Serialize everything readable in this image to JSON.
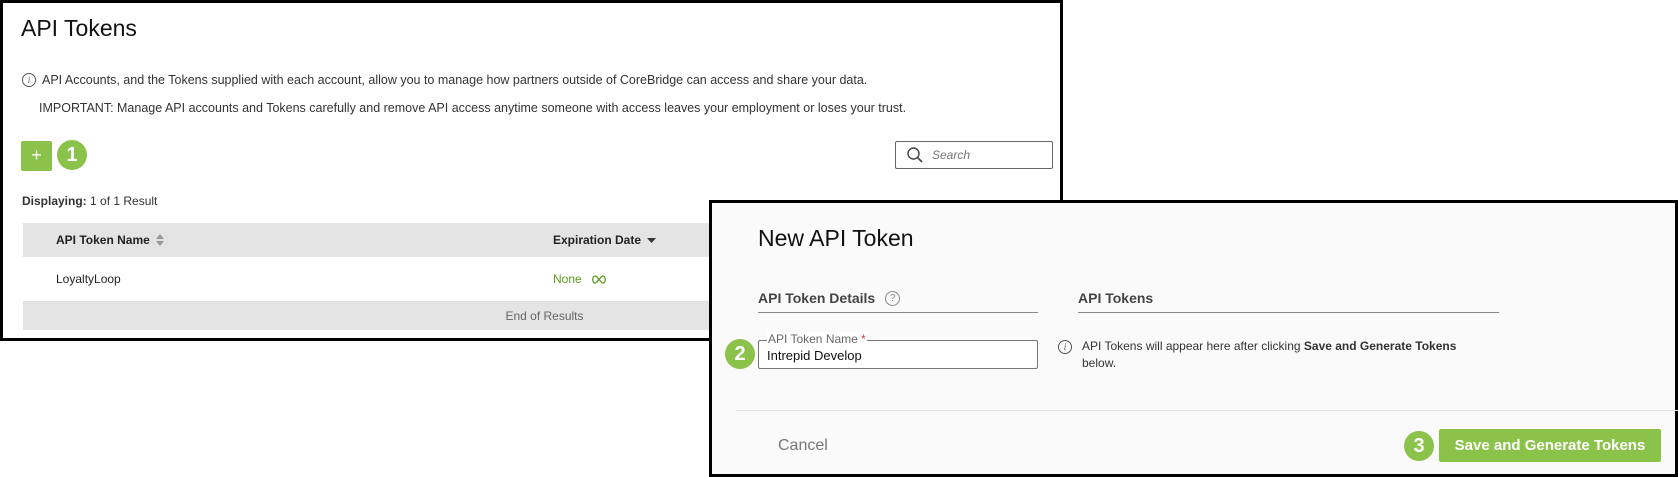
{
  "tokens_page": {
    "title": "API Tokens",
    "info_text": "API Accounts, and the Tokens supplied with each account, allow you to manage how partners outside of CoreBridge can access and share your data.",
    "important_text": "IMPORTANT: Manage API accounts and Tokens carefully and remove API access anytime someone with access leaves your employment or loses your trust.",
    "add_button_label": "+",
    "step1": "1",
    "search_placeholder": "Search",
    "displaying_label": "Displaying:",
    "displaying_value": " 1 of 1 Result",
    "table": {
      "col_name": "API Token Name",
      "col_expiration": "Expiration Date",
      "rows": [
        {
          "name": "LoyaltyLoop",
          "expiration": "None"
        }
      ],
      "end_text": "End of Results"
    }
  },
  "modal": {
    "title": "New API Token",
    "details_header": "API Token Details",
    "tokens_header": "API Tokens",
    "field_label": "API Token Name",
    "required_mark": "*",
    "field_value": "Intrepid Develop",
    "step2": "2",
    "note_prefix": "API Tokens will appear here after clicking ",
    "note_bold": "Save and Generate Tokens",
    "note_suffix": " below.",
    "cancel_label": "Cancel",
    "step3": "3",
    "save_label": "Save and Generate Tokens"
  },
  "colors": {
    "accent": "#8bc34a",
    "link_green": "#5a9e1e",
    "header_gray": "#e4e4e4"
  },
  "icons": [
    "info-icon",
    "search-icon",
    "sort-icon",
    "sort-down-icon",
    "infinity-icon",
    "help-icon"
  ]
}
